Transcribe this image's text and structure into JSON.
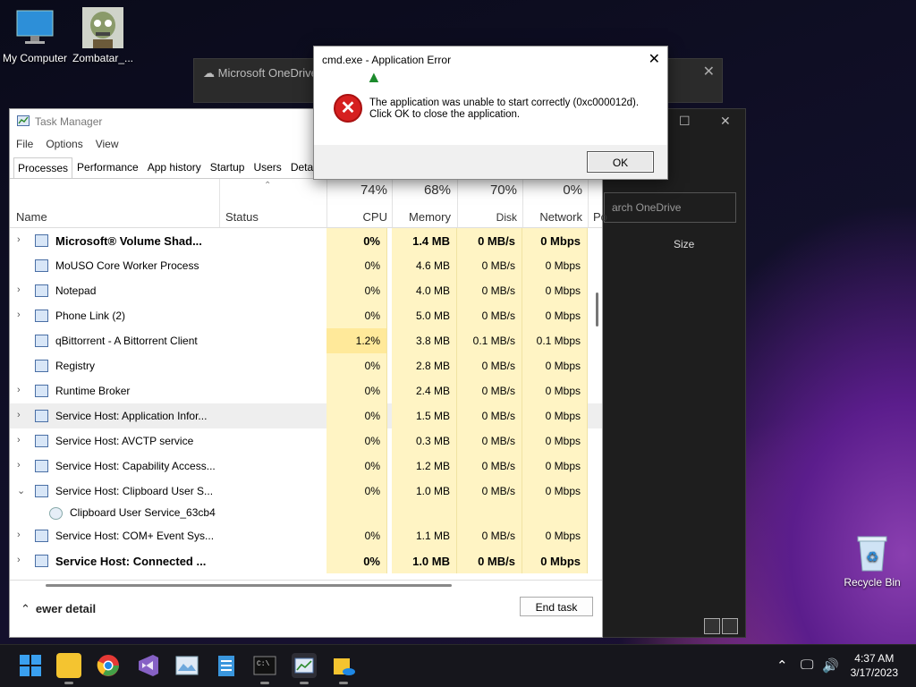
{
  "desktop": {
    "icons": [
      {
        "label": "My Computer",
        "icon": "monitor-icon"
      },
      {
        "label": "Zombatar_...",
        "icon": "zombie-icon"
      }
    ],
    "recycle_bin": "Recycle Bin"
  },
  "onedrive": {
    "title": "Microsoft OneDrive",
    "search_placeholder": "arch OneDrive",
    "size_header": "Size"
  },
  "task_manager": {
    "title": "Task Manager",
    "menu": [
      "File",
      "Options",
      "View"
    ],
    "tabs": [
      "Processes",
      "Performance",
      "App history",
      "Startup",
      "Users",
      "Detai"
    ],
    "columns": {
      "name": "Name",
      "status": "Status",
      "cpu": {
        "pct": "74%",
        "label": "CPU"
      },
      "memory": {
        "pct": "68%",
        "label": "Memory"
      },
      "disk": {
        "pct": "70%",
        "label": "Disk"
      },
      "network": {
        "pct": "0%",
        "label": "Network"
      },
      "power": "Po"
    },
    "rows": [
      {
        "name": "Microsoft® Volume Shad...",
        "cpu": "0%",
        "mem": "1.4 MB",
        "disk": "0 MB/s",
        "net": "0 Mbps",
        "expand": "›",
        "bold": true
      },
      {
        "name": "MoUSO Core Worker Process",
        "cpu": "0%",
        "mem": "4.6 MB",
        "disk": "0 MB/s",
        "net": "0 Mbps",
        "expand": ""
      },
      {
        "name": "Notepad",
        "cpu": "0%",
        "mem": "4.0 MB",
        "disk": "0 MB/s",
        "net": "0 Mbps",
        "expand": "›"
      },
      {
        "name": "Phone Link (2)",
        "cpu": "0%",
        "mem": "5.0 MB",
        "disk": "0 MB/s",
        "net": "0 Mbps",
        "expand": "›"
      },
      {
        "name": "qBittorrent - A Bittorrent Client",
        "cpu": "1.2%",
        "mem": "3.8 MB",
        "disk": "0.1 MB/s",
        "net": "0.1 Mbps",
        "expand": ""
      },
      {
        "name": "Registry",
        "cpu": "0%",
        "mem": "2.8 MB",
        "disk": "0 MB/s",
        "net": "0 Mbps",
        "expand": ""
      },
      {
        "name": "Runtime Broker",
        "cpu": "0%",
        "mem": "2.4 MB",
        "disk": "0 MB/s",
        "net": "0 Mbps",
        "expand": "›"
      },
      {
        "name": "Service Host: Application Infor...",
        "cpu": "0%",
        "mem": "1.5 MB",
        "disk": "0 MB/s",
        "net": "0 Mbps",
        "expand": "›",
        "selected": true
      },
      {
        "name": "Service Host: AVCTP service",
        "cpu": "0%",
        "mem": "0.3 MB",
        "disk": "0 MB/s",
        "net": "0 Mbps",
        "expand": "›"
      },
      {
        "name": "Service Host: Capability Access...",
        "cpu": "0%",
        "mem": "1.2 MB",
        "disk": "0 MB/s",
        "net": "0 Mbps",
        "expand": "›"
      },
      {
        "name": "Service Host: Clipboard User S...",
        "cpu": "0%",
        "mem": "1.0 MB",
        "disk": "0 MB/s",
        "net": "0 Mbps",
        "expand": "⌄"
      },
      {
        "name": "Clipboard User Service_63cb4",
        "cpu": "",
        "mem": "",
        "disk": "",
        "net": "",
        "expand": "",
        "child": true
      },
      {
        "name": "Service Host: COM+ Event Sys...",
        "cpu": "0%",
        "mem": "1.1 MB",
        "disk": "0 MB/s",
        "net": "0 Mbps",
        "expand": "›"
      },
      {
        "name": "Service Host: Connected ...",
        "cpu": "0%",
        "mem": "1.0 MB",
        "disk": "0 MB/s",
        "net": "0 Mbps",
        "expand": "›",
        "bold": true
      }
    ],
    "fewer_details": "ewer detail",
    "end_task": "End task"
  },
  "error_dialog": {
    "title": "cmd.exe - Application Error",
    "line1": "The application was unable to start correctly (0xc000012d).",
    "line2": "Click OK to close the application.",
    "ok": "OK"
  },
  "taskbar": {
    "apps": [
      "start-icon",
      "file-explorer-icon",
      "chrome-icon",
      "visual-studio-icon",
      "photos-icon",
      "notepad-icon",
      "terminal-icon",
      "task-manager-icon",
      "onedrive-folder-icon"
    ],
    "time": "4:37 AM",
    "date": "3/17/2023"
  }
}
